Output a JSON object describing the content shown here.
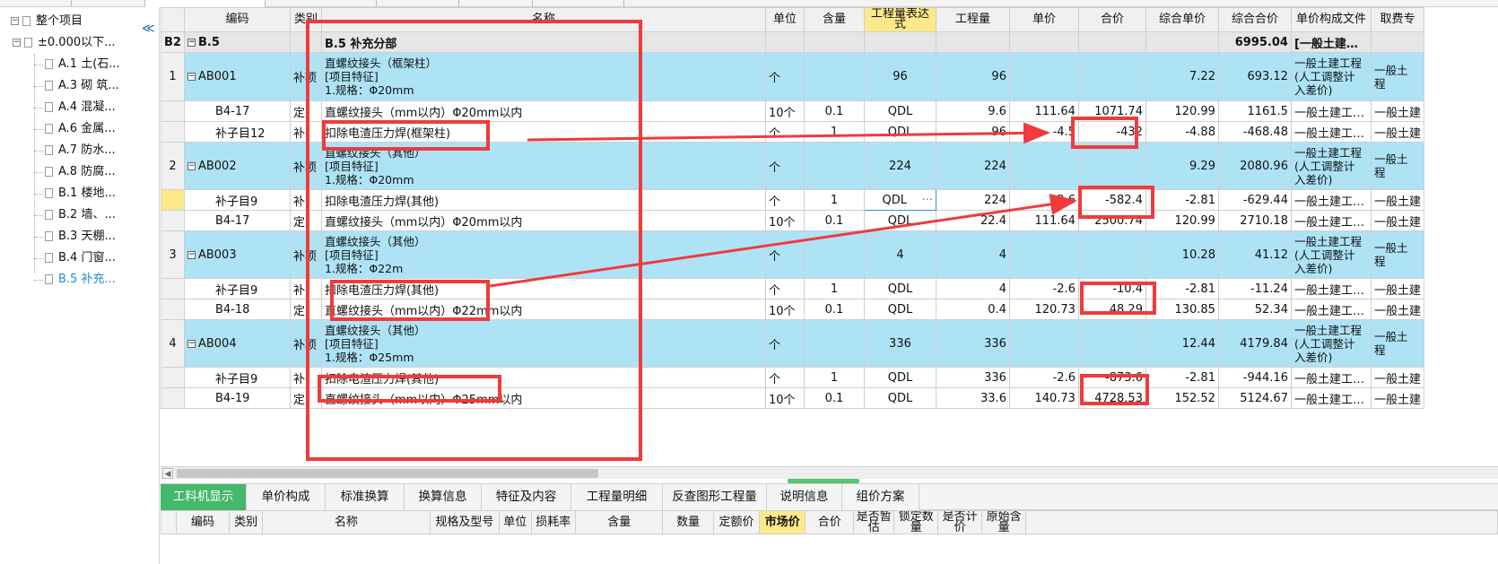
{
  "tree": {
    "root_label": "整个项目",
    "level1_label": "±0.000以下...",
    "items": [
      {
        "label": "A.1 土(石..."
      },
      {
        "label": "A.3 砌 筑..."
      },
      {
        "label": "A.4 混凝..."
      },
      {
        "label": "A.6 金属..."
      },
      {
        "label": "A.7 防水..."
      },
      {
        "label": "A.8 防腐..."
      },
      {
        "label": "B.1 楼地..."
      },
      {
        "label": "B.2 墙、..."
      },
      {
        "label": "B.3 天棚..."
      },
      {
        "label": "B.4 门窗..."
      },
      {
        "label": "B.5 补充..."
      }
    ],
    "selected_item": "B.5 补充..."
  },
  "grid": {
    "headers": {
      "code": "编码",
      "category": "类别",
      "name": "名称",
      "unit": "单位",
      "content": "含量",
      "expression": "工程量表达式",
      "quantity": "工程量",
      "unit_price": "单价",
      "total_price": "合价",
      "comp_unit_price": "综合单价",
      "comp_total_price": "综合合价",
      "price_file": "单价构成文件",
      "fee_file": "取费专"
    },
    "section": {
      "row_no": "B2",
      "code": "B.5",
      "name": "B.5  补充分部",
      "comp_total": "6995.04",
      "price_file": "[一般土建…"
    },
    "items": [
      {
        "row_no": "1",
        "code": "AB001",
        "category": "补项",
        "name_lines": [
          "直螺纹接头（框架柱）",
          "[项目特征]",
          "1.规格：Φ20mm"
        ],
        "unit": "个",
        "expression": "96",
        "quantity": "96",
        "comp_unit_price": "7.22",
        "comp_total": "693.12",
        "price_file_lines": [
          "一般土建工程",
          "(人工调整计",
          "入差价)"
        ],
        "fee_lines": [
          "一般土",
          "程"
        ],
        "subs": [
          {
            "code": "B4-17",
            "category": "定",
            "name": "直螺纹接头（mm以内）Φ20mm以内",
            "unit": "10个",
            "content": "0.1",
            "expression": "QDL",
            "quantity": "9.6",
            "unit_price": "111.64",
            "total_price": "1071.74",
            "comp_unit_price": "120.99",
            "comp_total": "1161.5",
            "price_file": "一般土建工…",
            "fee": "一般土建"
          },
          {
            "code": "补子目12",
            "category": "补",
            "name": "扣除电渣压力焊(框架柱)",
            "unit": "个",
            "content": "1",
            "expression": "QDL",
            "quantity": "96",
            "unit_price": "-4.5",
            "total_price": "-432",
            "comp_unit_price": "-4.88",
            "comp_total": "-468.48",
            "price_file": "一般土建工…",
            "fee": "一般土建"
          }
        ]
      },
      {
        "row_no": "2",
        "code": "AB002",
        "category": "补项",
        "name_lines": [
          "直螺纹接头（其他）",
          "[项目特征]",
          "1.规格：Φ20mm"
        ],
        "unit": "个",
        "expression": "224",
        "quantity": "224",
        "comp_unit_price": "9.29",
        "comp_total": "2080.96",
        "price_file_lines": [
          "一般土建工程",
          "(人工调整计",
          "入差价)"
        ],
        "fee_lines": [
          "一般土",
          "程"
        ],
        "subs": [
          {
            "code": "补子目9",
            "category": "补",
            "name": "扣除电渣压力焊(其他)",
            "unit": "个",
            "content": "1",
            "expression": "QDL",
            "quantity": "224",
            "unit_price": "-2.6",
            "total_price": "-582.4",
            "comp_unit_price": "-2.81",
            "comp_total": "-629.44",
            "price_file": "一般土建工…",
            "fee": "一般土建",
            "editing": true
          },
          {
            "code": "B4-17",
            "category": "定",
            "name": "直螺纹接头（mm以内）Φ20mm以内",
            "unit": "10个",
            "content": "0.1",
            "expression": "QDL",
            "quantity": "22.4",
            "unit_price": "111.64",
            "total_price": "2500.74",
            "comp_unit_price": "120.99",
            "comp_total": "2710.18",
            "price_file": "一般土建工…",
            "fee": "一般土建"
          }
        ]
      },
      {
        "row_no": "3",
        "code": "AB003",
        "category": "补项",
        "name_lines": [
          "直螺纹接头（其他）",
          "[项目特征]",
          "1.规格：Φ22m"
        ],
        "unit": "个",
        "expression": "4",
        "quantity": "4",
        "comp_unit_price": "10.28",
        "comp_total": "41.12",
        "price_file_lines": [
          "一般土建工程",
          "(人工调整计",
          "入差价)"
        ],
        "fee_lines": [
          "一般土",
          "程"
        ],
        "subs": [
          {
            "code": "补子目9",
            "category": "补",
            "name": "扣除电渣压力焊(其他)",
            "unit": "个",
            "content": "1",
            "expression": "QDL",
            "quantity": "4",
            "unit_price": "-2.6",
            "total_price": "-10.4",
            "comp_unit_price": "-2.81",
            "comp_total": "-11.24",
            "price_file": "一般土建工…",
            "fee": "一般土建"
          },
          {
            "code": "B4-18",
            "category": "定",
            "name": "直螺纹接头（mm以内）Φ22mm以内",
            "unit": "10个",
            "content": "0.1",
            "expression": "QDL",
            "quantity": "0.4",
            "unit_price": "120.73",
            "total_price": "48.29",
            "comp_unit_price": "130.85",
            "comp_total": "52.34",
            "price_file": "一般土建工…",
            "fee": "一般土建"
          }
        ]
      },
      {
        "row_no": "4",
        "code": "AB004",
        "category": "补项",
        "name_lines": [
          "直螺纹接头（其他）",
          "[项目特征]",
          "1.规格：Φ25mm"
        ],
        "unit": "个",
        "expression": "336",
        "quantity": "336",
        "comp_unit_price": "12.44",
        "comp_total": "4179.84",
        "price_file_lines": [
          "一般土建工程",
          "(人工调整计",
          "入差价)"
        ],
        "fee_lines": [
          "一般土",
          "程"
        ],
        "subs": [
          {
            "code": "补子目9",
            "category": "补",
            "name": "扣除电渣压力焊(其他)",
            "unit": "个",
            "content": "1",
            "expression": "QDL",
            "quantity": "336",
            "unit_price": "-2.6",
            "total_price": "-873.6",
            "comp_unit_price": "-2.81",
            "comp_total": "-944.16",
            "price_file": "一般土建工…",
            "fee": "一般土建"
          },
          {
            "code": "B4-19",
            "category": "定",
            "name": "直螺纹接头（mm以内）Φ25mm以内",
            "unit": "10个",
            "content": "0.1",
            "expression": "QDL",
            "quantity": "33.6",
            "unit_price": "140.73",
            "total_price": "4728.53",
            "comp_unit_price": "152.52",
            "comp_total": "5124.67",
            "price_file": "一般土建工…",
            "fee": "一般土建"
          }
        ]
      }
    ]
  },
  "bottom_tabs": [
    "工料机显示",
    "单价构成",
    "标准换算",
    "换算信息",
    "特征及内容",
    "工程量明细",
    "反查图形工程量",
    "说明信息",
    "组价方案"
  ],
  "active_bottom_tab": "工料机显示",
  "bottom_headers": [
    "",
    "编码",
    "类别",
    "名称",
    "规格及型号",
    "单位",
    "损耗率",
    "含量",
    "数量",
    "定额价",
    "市场价",
    "合价",
    "是否暂估",
    "锁定数量",
    "是否计价",
    "原始含量",
    ""
  ],
  "bottom_header_highlight": "市场价",
  "colors": {
    "item_row_bg": "#aee3f6",
    "active_tab_bg": "#45b86a",
    "highlight_header_bg": "#fde98a",
    "annotation_red": "#ef3b3b",
    "selected_tree_text": "#1b8fd2"
  }
}
